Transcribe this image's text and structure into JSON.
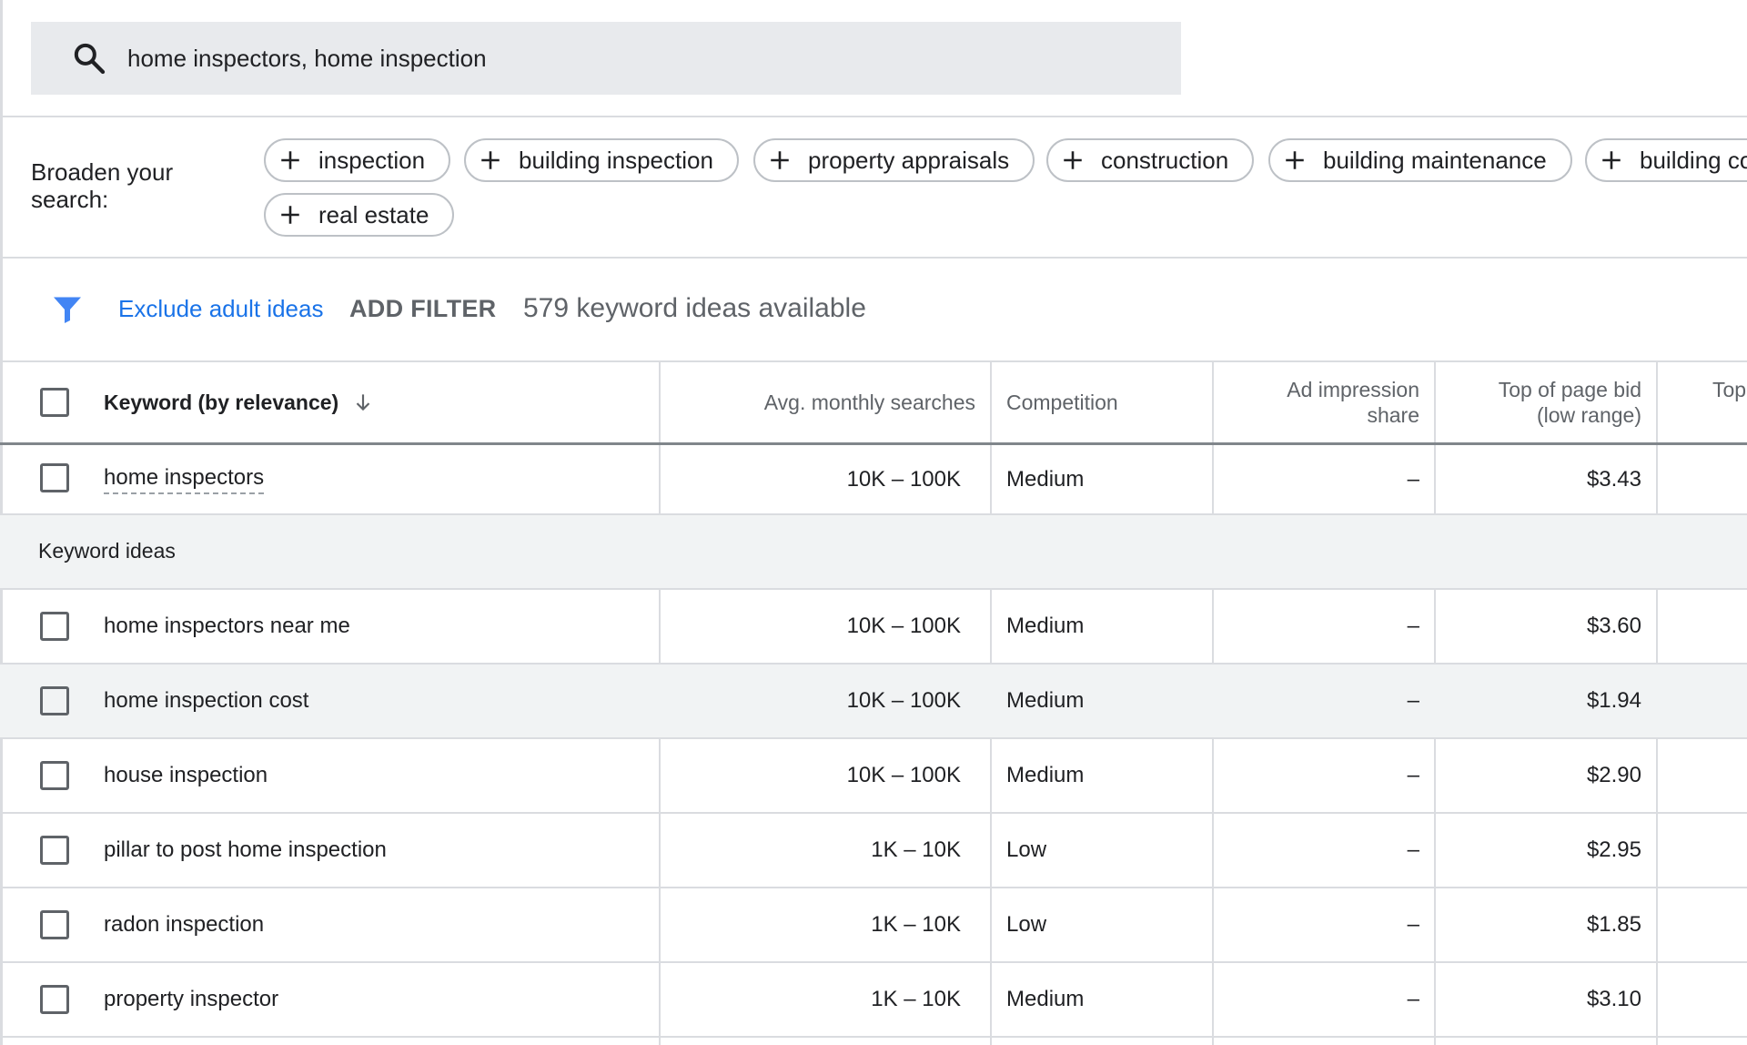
{
  "search": {
    "query": "home inspectors, home inspection"
  },
  "broaden": {
    "label": "Broaden your search:",
    "chips": [
      "inspection",
      "building inspection",
      "property appraisals",
      "construction",
      "building maintenance",
      "building co",
      "real estate"
    ]
  },
  "filter_bar": {
    "exclude_link": "Exclude adult ideas",
    "add_filter": "ADD FILTER",
    "ideas_count": "579 keyword ideas available"
  },
  "table": {
    "headers": {
      "keyword": "Keyword (by relevance)",
      "searches": "Avg. monthly searches",
      "competition": "Competition",
      "impression_line1": "Ad impression",
      "impression_line2": "share",
      "bid_low_line1": "Top of page bid",
      "bid_low_line2": "(low range)",
      "bid_high_partial": "Top"
    },
    "provided": {
      "keyword": "home inspectors",
      "searches": "10K – 100K",
      "competition": "Medium",
      "share": "–",
      "bid_low": "$3.43"
    },
    "section_label": "Keyword ideas",
    "rows": [
      {
        "keyword": "home inspectors near me",
        "searches": "10K – 100K",
        "competition": "Medium",
        "share": "–",
        "bid_low": "$3.60"
      },
      {
        "keyword": "home inspection cost",
        "searches": "10K – 100K",
        "competition": "Medium",
        "share": "–",
        "bid_low": "$1.94"
      },
      {
        "keyword": "house inspection",
        "searches": "10K – 100K",
        "competition": "Medium",
        "share": "–",
        "bid_low": "$2.90"
      },
      {
        "keyword": "pillar to post home inspection",
        "searches": "1K – 10K",
        "competition": "Low",
        "share": "–",
        "bid_low": "$2.95"
      },
      {
        "keyword": "radon inspection",
        "searches": "1K – 10K",
        "competition": "Low",
        "share": "–",
        "bid_low": "$1.85"
      },
      {
        "keyword": "property inspector",
        "searches": "1K – 10K",
        "competition": "Medium",
        "share": "–",
        "bid_low": "$3.10"
      }
    ]
  },
  "colors": {
    "link": "#1a73e8",
    "filter_icon": "#4285f4",
    "muted": "#5f6368",
    "row_highlight": "#f1f3f4"
  }
}
